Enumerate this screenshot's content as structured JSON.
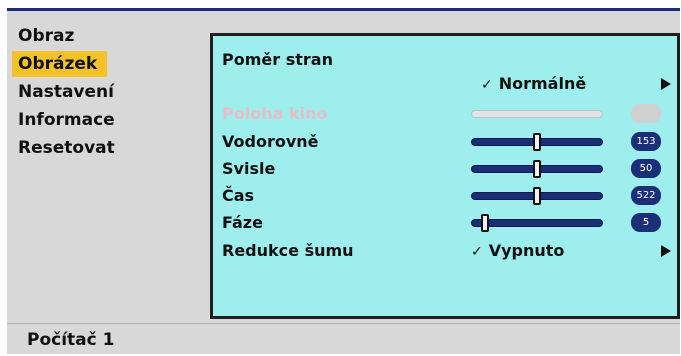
{
  "menu": {
    "items": [
      {
        "label": "Obraz"
      },
      {
        "label": "Obrázek"
      },
      {
        "label": "Nastavení"
      },
      {
        "label": "Informace"
      },
      {
        "label": "Resetovat"
      }
    ],
    "selected_index": 1
  },
  "panel": {
    "aspect_label": "Poměr stran",
    "aspect_value": "Normálně",
    "cinema_label": "Poloha kino",
    "horizontal_label": "Vodorovně",
    "horizontal_value": "153",
    "horizontal_level": 0.5,
    "vertical_label": "Svisle",
    "vertical_value": "50",
    "vertical_level": 0.5,
    "clock_label": "Čas",
    "clock_value": "522",
    "clock_level": 0.5,
    "phase_label": "Fáze",
    "phase_value": "5",
    "phase_level": 0.1,
    "noise_label": "Redukce šumu",
    "noise_value": "Vypnuto",
    "check_mark": "✓"
  },
  "footer": {
    "source": "Počítač 1"
  },
  "colors": {
    "panel_bg": "#9eeeee",
    "selected_bg": "#f2c228",
    "slider_fill": "#1b2f78",
    "frame_top": "#1e2d78"
  }
}
